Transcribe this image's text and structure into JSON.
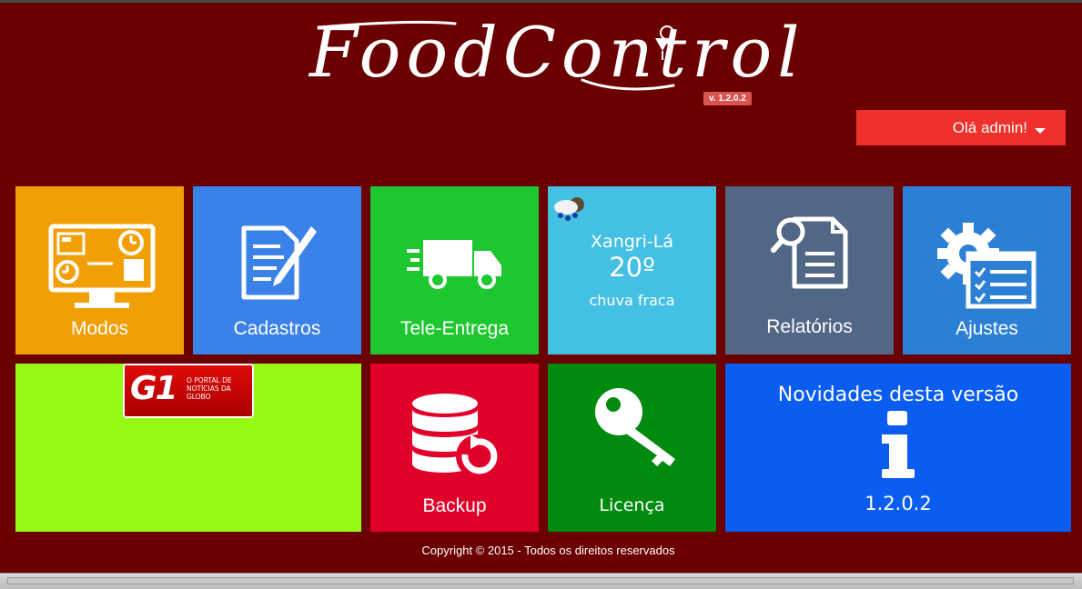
{
  "app": {
    "logo_text": "FoodControl",
    "version_badge": "v. 1.2.0.2"
  },
  "user_menu": {
    "label": "Olá admin!",
    "icon": "caret-down-icon"
  },
  "tiles": {
    "modos": {
      "label": "Modos",
      "color": "#f29f05",
      "icon": "monitor-clock-icon"
    },
    "cadastros": {
      "label": "Cadastros",
      "color": "#3b82e8",
      "icon": "document-pen-icon"
    },
    "tele_entrega": {
      "label": "Tele-Entrega",
      "color": "#1ec730",
      "icon": "truck-icon"
    },
    "weather": {
      "city": "Xangri-Lá",
      "temperature": "20º",
      "description": "chuva fraca",
      "icon": "rain-cloud-icon",
      "color": "#45c0e5"
    },
    "relatorios": {
      "label": "Relatórios",
      "color": "#526785",
      "icon": "report-search-icon"
    },
    "ajustes": {
      "label": "Ajustes",
      "color": "#2b80d6",
      "icon": "gear-checklist-icon"
    },
    "news": {
      "color": "#96fa14",
      "logo_mark": "G1",
      "logo_tagline": "O PORTAL DE NOTÍCIAS DA GLOBO"
    },
    "backup": {
      "label": "Backup",
      "color": "#e1002a",
      "icon": "database-refresh-icon"
    },
    "licenca": {
      "label": "Licença",
      "color": "#008a0e",
      "icon": "key-icon"
    },
    "novidades": {
      "title": "Novidades desta versão",
      "version": "1.2.0.2",
      "icon": "info-icon",
      "color": "#0a5df0"
    }
  },
  "footer": {
    "copyright": "Copyright © 2015 - Todos os direitos reservados"
  }
}
